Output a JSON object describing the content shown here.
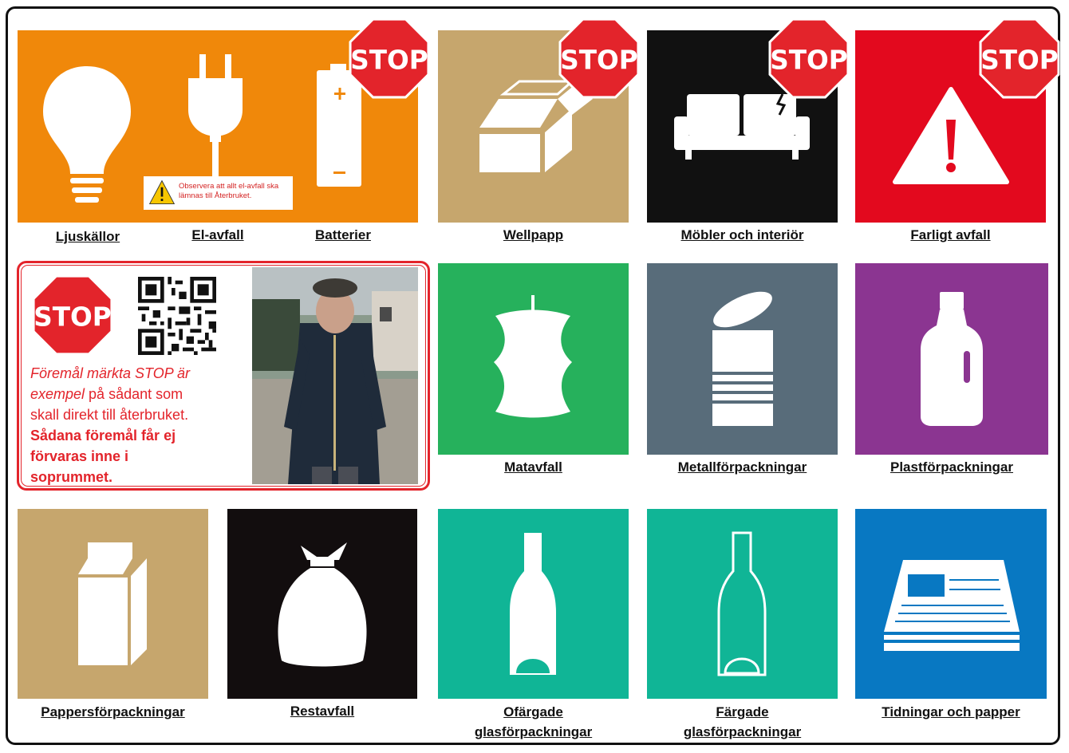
{
  "labels": {
    "ljuskallor": "Ljuskällor",
    "el_avfall": "El-avfall",
    "batterier": "Batterier",
    "wellpapp": "Wellpapp",
    "mobler": "Möbler och interiör",
    "farligt": "Farligt avfall",
    "matavfall": "Matavfall",
    "metall": "Metallförpackningar",
    "plast": "Plastförpackningar",
    "papper": "Pappersförpackningar",
    "restavfall": "Restavfall",
    "ofargade_1": "Ofärgade",
    "ofargade_2": "glasförpackningar",
    "fargade_1": "Färgade",
    "fargade_2": "glasförpackningar",
    "tidningar": "Tidningar och papper"
  },
  "stop_sign_text": "STOP",
  "warning_note": {
    "line1": "Observera att allt el-avfall ska",
    "line2": "lämnas till Återbruket."
  },
  "info_box": {
    "italic_1": "Föremål märkta STOP är",
    "italic_2": "exempel",
    "text_1": " på sådant  som",
    "text_2": "skall direkt till återbruket.",
    "bold_1": "Sådana föremål får ej",
    "bold_2": "förvaras  inne i",
    "bold_3": "soprummet."
  },
  "colors": {
    "orange": "#f0880a",
    "tan": "#c6a66d",
    "black": "#111111",
    "red": "#e3091e",
    "green": "#26b15c",
    "slate": "#586c7a",
    "purple": "#8b3591",
    "dark": "#120d0e",
    "teal": "#10b596",
    "blue": "#0878c2",
    "stop_red": "#e3242b"
  },
  "icons": [
    "light-bulb-icon",
    "plug-icon",
    "battery-icon",
    "box-icon",
    "sofa-icon",
    "warning-icon",
    "apple-core-icon",
    "tin-can-icon",
    "plastic-bottle-icon",
    "milk-carton-icon",
    "trash-bag-icon",
    "clear-glass-bottle-icon",
    "colored-glass-bottle-icon",
    "newspaper-icon",
    "qr-code",
    "man-photo"
  ]
}
